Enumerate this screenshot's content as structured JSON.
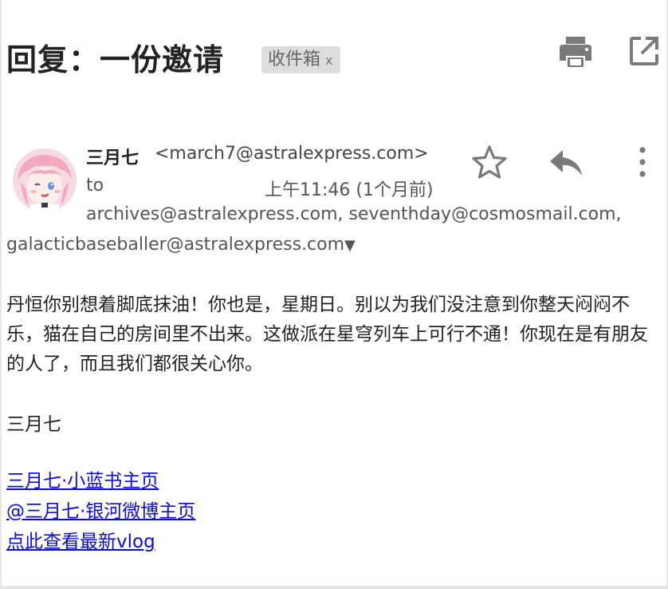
{
  "header": {
    "subject": "回复：一份邀请",
    "label": "收件箱",
    "label_remove": "x"
  },
  "icons": {
    "print": "print-icon",
    "popout": "open-in-new-window-icon",
    "star": "star-icon",
    "reply": "reply-icon",
    "more": "more-vertical-icon",
    "avatar": "sender-avatar-image"
  },
  "message": {
    "sender_name": "三月七",
    "sender_email": "<march7@astralexpress.com>",
    "to_label": "to",
    "time": "上午11:46 (1个月前)",
    "recipients_line1": "archives@astralexpress.com, seventhday@cosmosmail.com,",
    "recipients_line2": "galacticbaseballer@astralexpress.com",
    "recipients_toggle": "▼",
    "body": "丹恒你别想着脚底抹油！你也是，星期日。别以为我们没注意到你整天闷闷不乐，猫在自己的房间里不出来。这做派在星穹列车上可行不通！你现在是有朋友的人了，而且我们都很关心你。",
    "signature": "三月七",
    "links": [
      "三月七·小蓝书主页",
      "@三月七·银河微博主页 ",
      "点此查看最新vlog"
    ]
  },
  "colors": {
    "icon_gray": "#7a7a7a",
    "link_blue": "#0b0bd6",
    "chip_bg": "#dddddd"
  }
}
